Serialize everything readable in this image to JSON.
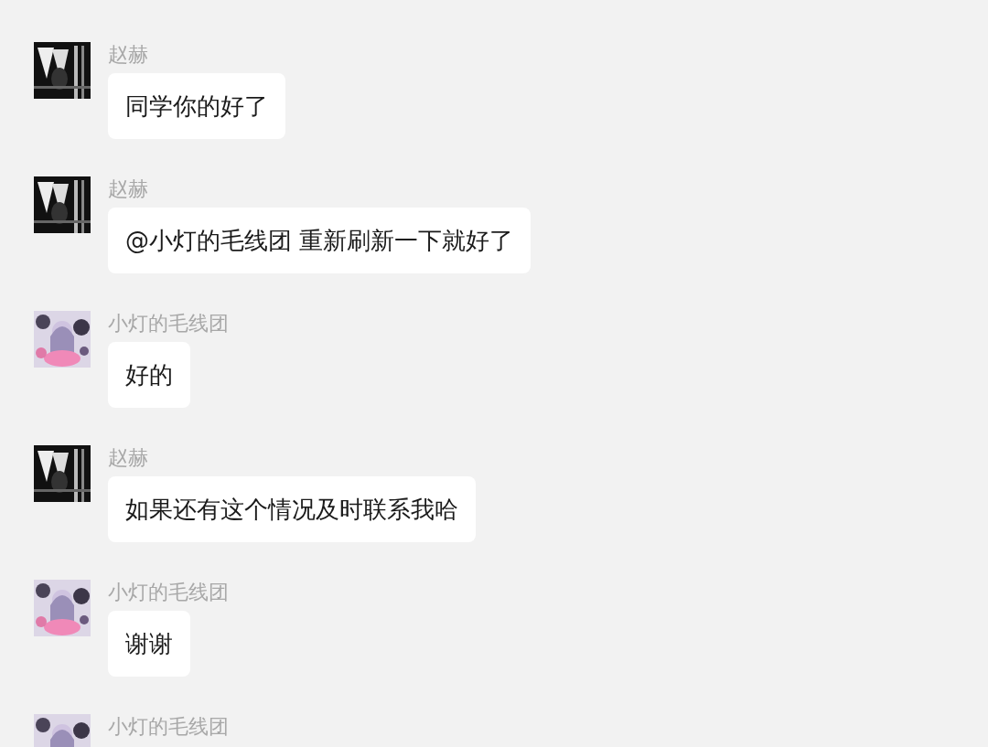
{
  "messages": [
    {
      "sender": "赵赫",
      "text": "同学你的好了"
    },
    {
      "sender": "赵赫",
      "text": "@小灯的毛线团 重新刷新一下就好了"
    },
    {
      "sender": "小灯的毛线团",
      "text": "好的"
    },
    {
      "sender": "赵赫",
      "text": "如果还有这个情况及时联系我哈"
    },
    {
      "sender": "小灯的毛线团",
      "text": "谢谢"
    },
    {
      "sender": "小灯的毛线团"
    }
  ]
}
